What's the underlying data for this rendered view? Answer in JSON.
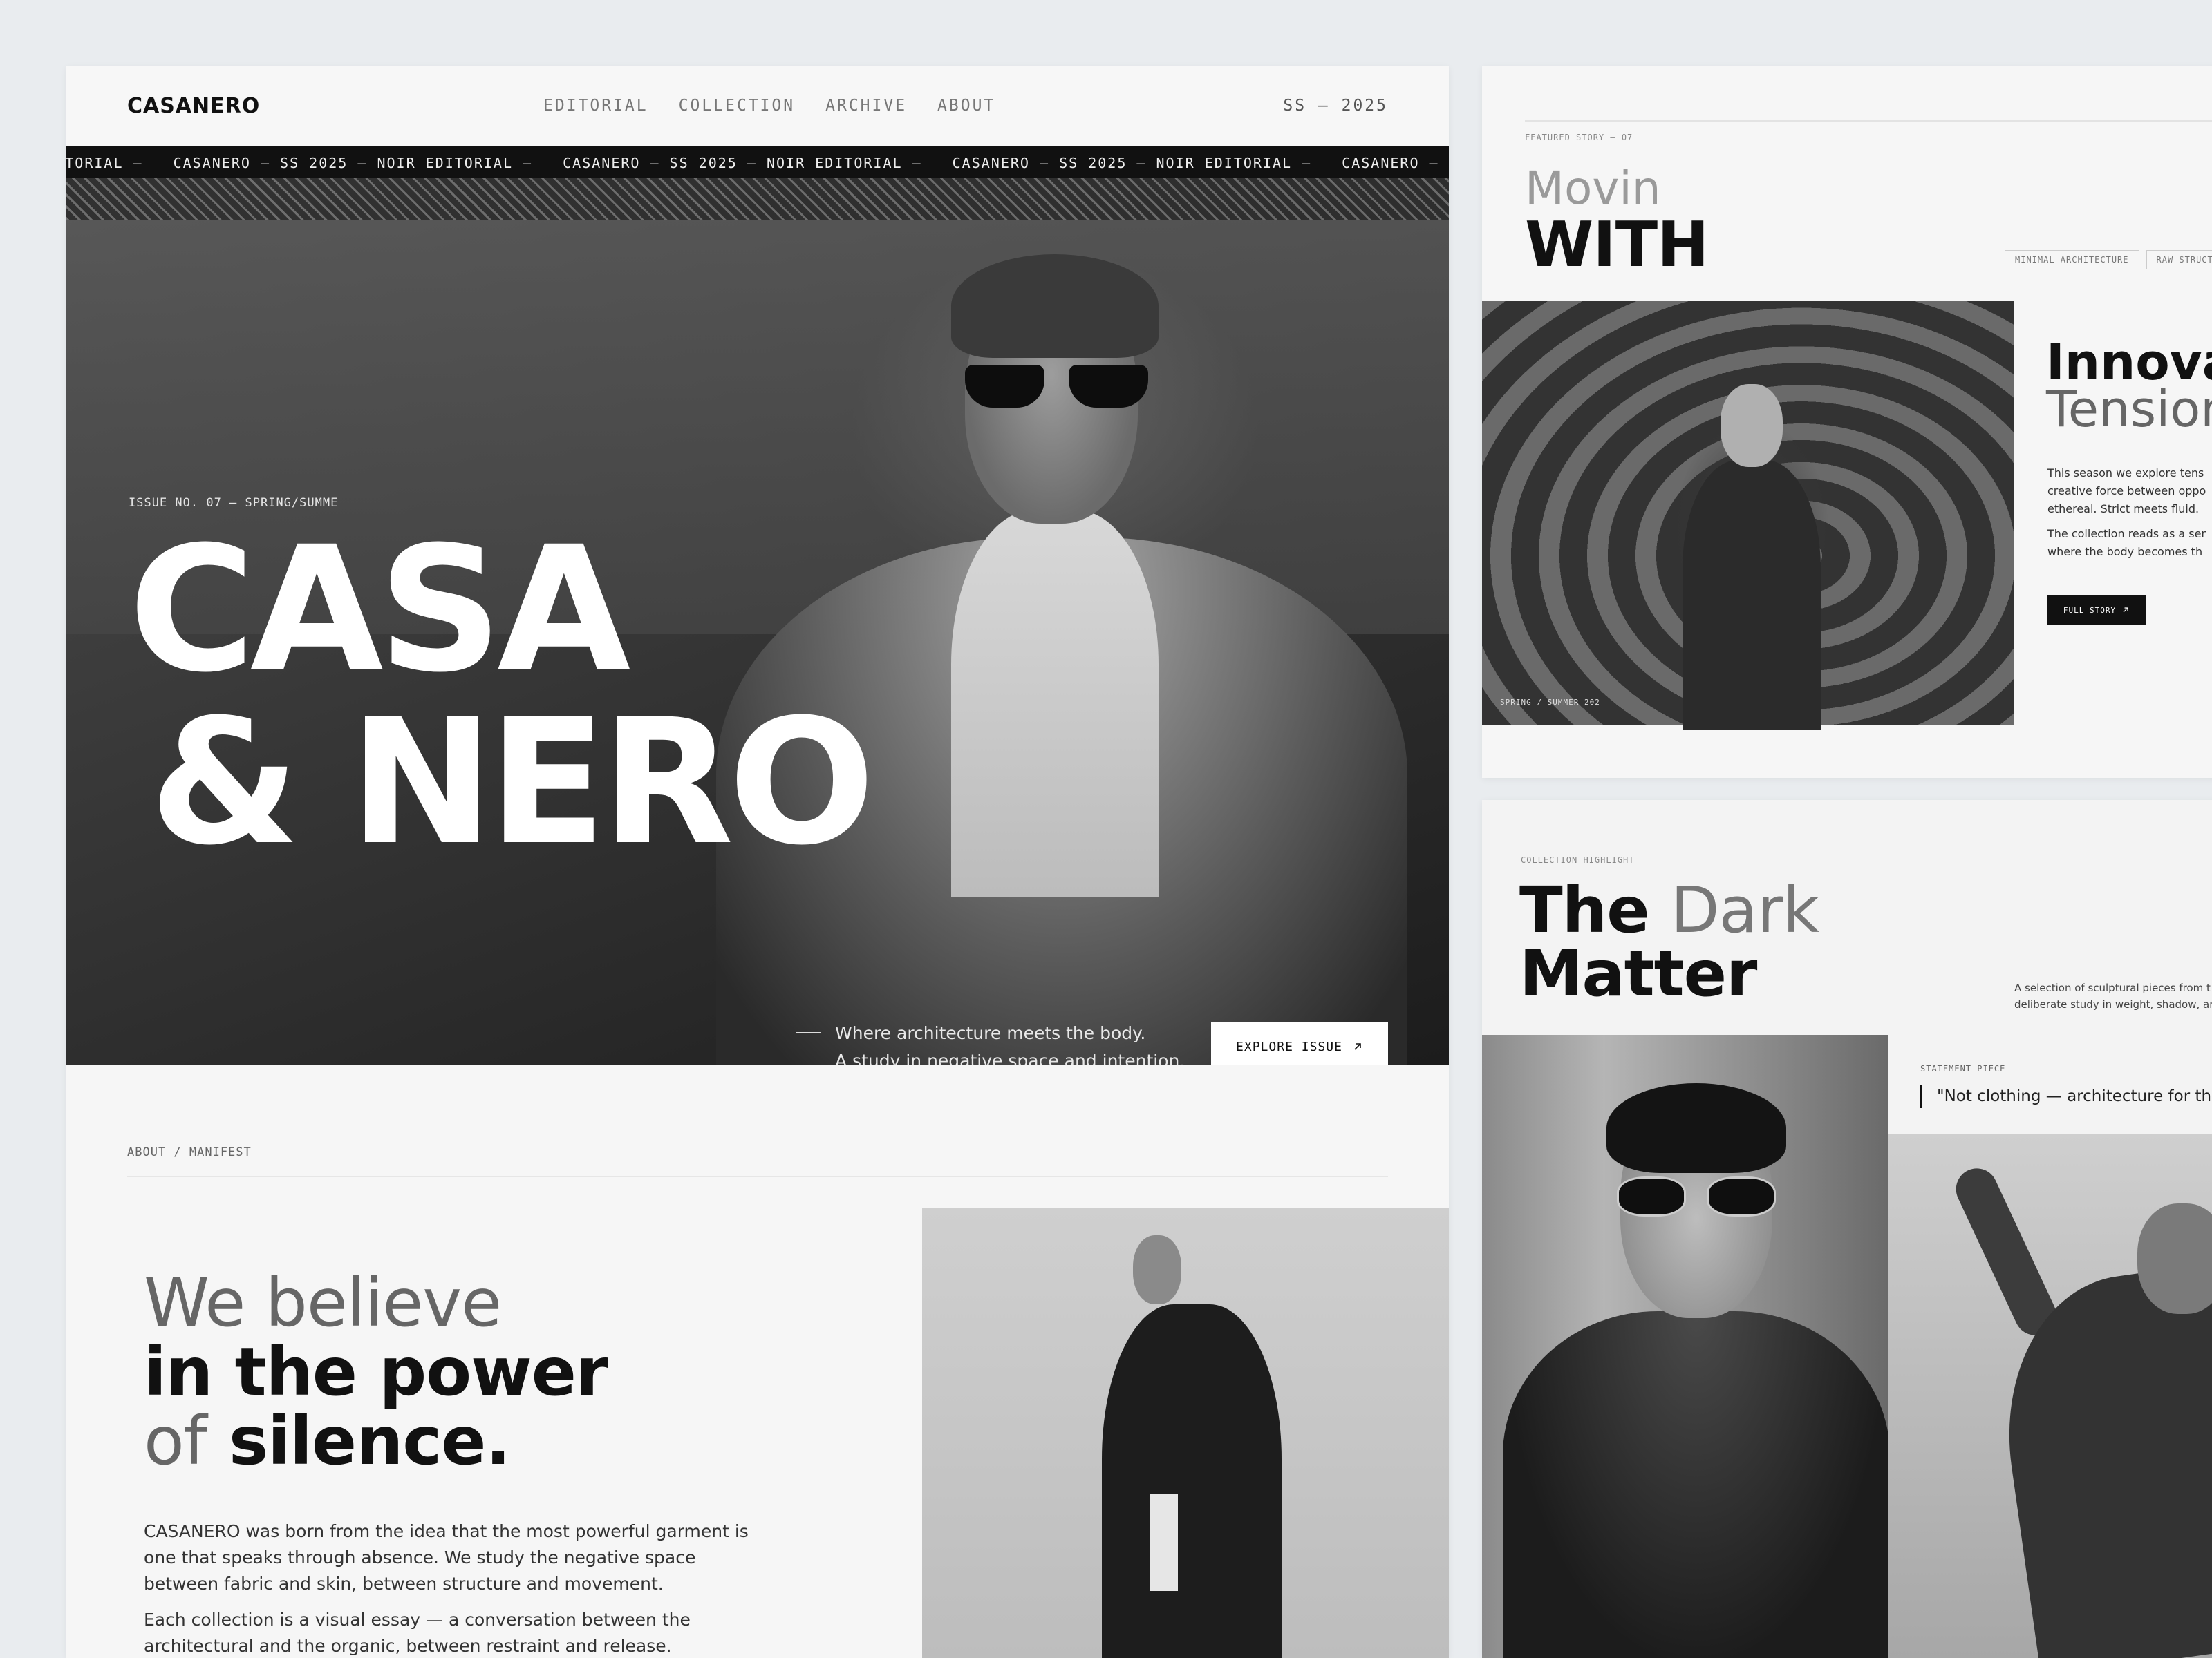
{
  "main": {
    "brand": "CASANERO",
    "nav": [
      "EDITORIAL",
      "COLLECTION",
      "ARCHIVE",
      "ABOUT"
    ],
    "season": "SS — 2025",
    "ticker": [
      "RO EDITORIAL —",
      "CASANERO — SS 2025 — NOIR EDITORIAL —",
      "CASANERO — SS 2025 — NOIR EDITORIAL —",
      "CASANERO — SS 2025 — NOIR EDITORIAL —",
      "CASANERO — SS"
    ],
    "hero": {
      "issue": "ISSUE NO. 07 — SPRING/SUMME",
      "title_line1": "CASA",
      "title_line2": "& NERO",
      "tagline_1": "Where architecture meets the body.",
      "tagline_2": "A study in negative space and intention.",
      "cta": "EXPLORE ISSUE",
      "cta_icon": "arrow-up-right-icon"
    },
    "about": {
      "label": "ABOUT / MANIFEST",
      "h_we_believe": "We believe",
      "h_in_the_power": "in the power",
      "h_of": "of",
      "h_silence": "silence.",
      "p1_l1": "CASANERO was born from the idea that the most powerful garment is",
      "p1_l2": "one that speaks through absence. We study the negative space",
      "p1_l3": "between fabric and skin, between structure and movement.",
      "p2_l1": "Each collection is a visual essay — a conversation between the",
      "p2_l2": "architectural and the organic, between restraint and release."
    }
  },
  "featured": {
    "label": "FEATURED STORY — 07",
    "title_light": "Movin",
    "title_bold": "WITH",
    "tags": [
      "MINIMAL ARCHITECTURE",
      "RAW STRUCTURE"
    ],
    "photo_caption": "SPRING / SUMMER 202",
    "heading_bold": "Innovat",
    "heading_light": "Tension",
    "p1_l1": "This season we explore tens",
    "p1_l2": "creative force between oppo",
    "p1_l3": "ethereal. Strict meets fluid.",
    "p2_l1": "The collection reads as a ser",
    "p2_l2": "where the body becomes th",
    "cta": "FULL STORY",
    "cta_icon": "arrow-up-right-icon"
  },
  "collection": {
    "label": "COLLECTION HIGHLIGHT",
    "title_the": "The",
    "title_dark": "Dark",
    "title_matter": "Matter",
    "desc_l1": "A selection of sculptural pieces from t",
    "desc_l2": "deliberate study in weight, shadow, ar",
    "statement_label": "STATEMENT PIECE",
    "quote": "\"Not clothing — architecture for the"
  }
}
